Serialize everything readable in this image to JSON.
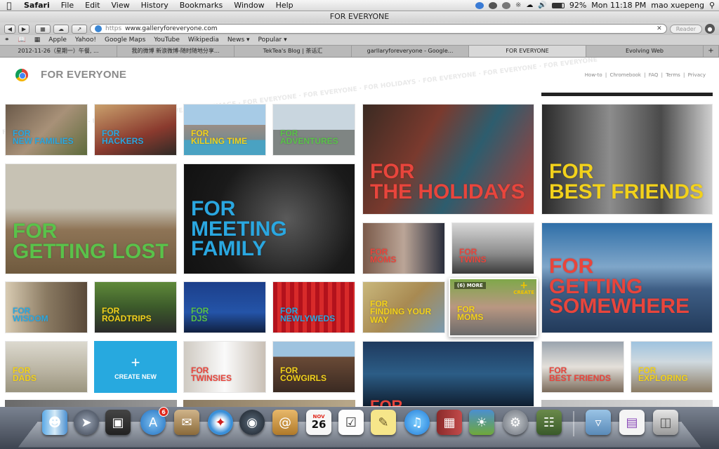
{
  "menubar": {
    "apple_icon": "apple-logo-icon",
    "items": [
      "Safari",
      "File",
      "Edit",
      "View",
      "History",
      "Bookmarks",
      "Window",
      "Help"
    ],
    "battery": "92%",
    "clock": "Mon 11:18 PM",
    "user": "mao xuepeng",
    "status_icons": [
      "sync-icon",
      "user-icon",
      "time-machine-icon",
      "bluetooth-icon",
      "wifi-icon",
      "volume-icon",
      "battery-icon"
    ],
    "spotlight_icon": "spotlight-icon"
  },
  "window": {
    "title": "FOR EVERYONE"
  },
  "toolbar": {
    "back_icon": "back-icon",
    "forward_icon": "forward-icon",
    "sidebar_icon": "sidebar-icon",
    "cloud_icon": "icloud-icon",
    "share_icon": "share-icon",
    "globe_icon": "globe-icon",
    "https": "https",
    "url": "www.galleryforeveryone.com",
    "clear_icon": "clear-icon",
    "reader": "Reader",
    "download_icon": "download-icon"
  },
  "bookmarks": {
    "reading_list_icon": "reading-list-icon",
    "book_icon": "bookmarks-icon",
    "grid_icon": "top-sites-icon",
    "items": [
      "Apple",
      "Yahoo!",
      "Google Maps",
      "YouTube",
      "Wikipedia",
      "News ▾",
      "Popular ▾"
    ]
  },
  "tabs": [
    "2012-11-26（星期一）午餐, ...",
    "我的微博 新浪微博-随时随地分享...",
    "TekTea's Blog | 茶话汇",
    "garllaryforeveryone - Google...",
    "FOR EVERYONE",
    "Evolving Web",
    "+"
  ],
  "site": {
    "title": "FOR EVERYONE",
    "nav": [
      "How-to",
      "|",
      "Chromebook",
      "|",
      "FAQ",
      "|",
      "Terms",
      "|",
      "Privacy"
    ],
    "ribbon": "FOR EVERYONE · IMAGE · FOR EVERYONE · FOR EVERYONE · IMAGE · FOR EVERYONE · FOR EVERYONE · FOR HOLIDAYS · FOR EVERYONE · FOR EVERYONE · FOR EVERYONE"
  },
  "tiles": [
    {
      "name": "tile-new-families",
      "l1": "FOR",
      "l2": "NEW FAMILIES",
      "color": "#2aa7e0"
    },
    {
      "name": "tile-hackers",
      "l1": "FOR",
      "l2": "HACKERS",
      "color": "#2aa7e0"
    },
    {
      "name": "tile-killing-time",
      "l1": "FOR",
      "l2": "KILLING TIME",
      "color": "#f2d11b"
    },
    {
      "name": "tile-adventures",
      "l1": "FOR",
      "l2": "ADVENTURES",
      "color": "#5ac24a"
    },
    {
      "name": "tile-holidays",
      "l1": "FOR",
      "l2": "THE HOLIDAYS",
      "color": "#e8453c"
    },
    {
      "name": "tile-best-friends-large",
      "l1": "FOR",
      "l2": "BEST FRIENDS",
      "color": "#f2d11b"
    },
    {
      "name": "tile-getting-lost",
      "l1": "FOR",
      "l2": "GETTING LOST",
      "color": "#5ac24a"
    },
    {
      "name": "tile-meeting-family",
      "l1": "FOR",
      "l2": "MEETING",
      "l3": "FAMILY",
      "color": "#2aa7e0"
    },
    {
      "name": "tile-moms-1",
      "l1": "FOR",
      "l2": "MOMS",
      "color": "#e8453c"
    },
    {
      "name": "tile-twins",
      "l1": "FOR",
      "l2": "TWINS",
      "color": "#e8453c"
    },
    {
      "name": "tile-getting-somewhere",
      "l1": "FOR",
      "l2": "GETTING",
      "l3": "SOMEWHERE",
      "color": "#e8453c"
    },
    {
      "name": "tile-wisdom",
      "l1": "FOR",
      "l2": "WISDOM",
      "color": "#2aa7e0"
    },
    {
      "name": "tile-roadtrips",
      "l1": "FOR",
      "l2": "ROADTRIPS",
      "color": "#f2d11b"
    },
    {
      "name": "tile-djs",
      "l1": "FOR",
      "l2": "DJS",
      "color": "#5ac24a"
    },
    {
      "name": "tile-newlyweds",
      "l1": "FOR",
      "l2": "NEWLYWEDS",
      "color": "#2aa7e0"
    },
    {
      "name": "tile-finding-your-way",
      "l1": "FOR",
      "l2": "FINDING YOUR",
      "l3": "WAY",
      "color": "#f2d11b"
    },
    {
      "name": "tile-moms-2",
      "l1": "FOR",
      "l2": "MOMS",
      "color": "#f2d11b",
      "more": "(6) MORE",
      "create": "CREATE"
    },
    {
      "name": "tile-dads",
      "l1": "FOR",
      "l2": "DADS",
      "color": "#f2d11b"
    },
    {
      "name": "tile-twinsies",
      "l1": "FOR",
      "l2": "TWINSIES",
      "color": "#e8453c"
    },
    {
      "name": "tile-cowgirls",
      "l1": "FOR",
      "l2": "COWGIRLS",
      "color": "#f2d11b"
    },
    {
      "name": "tile-city-night",
      "l1": "FOR",
      "l2": "",
      "color": "#e8453c"
    },
    {
      "name": "tile-best-friends-small",
      "l1": "FOR",
      "l2": "BEST FRIENDS",
      "color": "#e8453c"
    },
    {
      "name": "tile-exploring",
      "l1": "FOR",
      "l2": "EXPLORING",
      "color": "#f2d11b"
    }
  ],
  "create_new": {
    "plus": "+",
    "label": "CREATE NEW"
  },
  "dock": {
    "apps": [
      "finder-icon",
      "launchpad-icon",
      "photo-booth-icon",
      "app-store-icon",
      "mail-icon",
      "safari-icon",
      "facetime-icon",
      "contacts-icon",
      "calendar-icon",
      "reminders-icon",
      "notes-icon",
      "itunes-icon",
      "photo-stack-icon",
      "iphoto-icon",
      "system-preferences-icon",
      "dictionary-icon",
      "downloads-stack-icon",
      "documents-stack-icon",
      "trash-icon"
    ],
    "app_store_badge": "6",
    "calendar_month": "NOV",
    "calendar_day": "26"
  }
}
